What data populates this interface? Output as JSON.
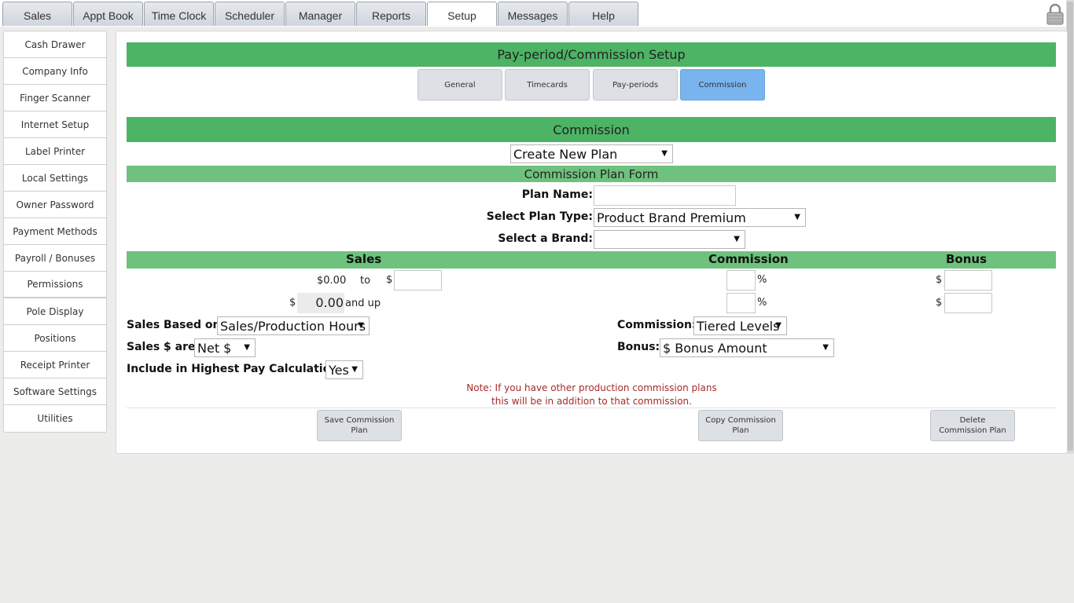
{
  "top_tabs": [
    "Sales",
    "Appt Book",
    "Time Clock",
    "Scheduler",
    "Manager",
    "Reports",
    "Setup",
    "Messages",
    "Help"
  ],
  "active_top_tab": "Setup",
  "sidebar": {
    "items": [
      "Cash Drawer",
      "Company Info",
      "Finger Scanner",
      "Internet Setup",
      "Label Printer",
      "Local Settings",
      "Owner Password",
      "Payment Methods",
      "Payroll / Bonuses",
      "Permissions",
      "Pole Display",
      "Positions",
      "Receipt Printer",
      "Software Settings",
      "Utilities"
    ]
  },
  "setup": {
    "title": "Pay-period/Commission Setup",
    "tabs": [
      "General",
      "Timecards",
      "Pay-periods",
      "Commission"
    ],
    "active_tab": "Commission"
  },
  "commission": {
    "title": "Commission",
    "plan_select": "Create New Plan",
    "form_title": "Commission Plan Form",
    "plan_name_label": "Plan Name:",
    "plan_name_value": "",
    "plan_type_label": "Select Plan Type:",
    "plan_type_value": "Product Brand Premium",
    "brand_label": "Select a Brand:",
    "brand_value": "",
    "headers": {
      "sales": "Sales",
      "commission": "Commission",
      "bonus": "Bonus"
    },
    "row1": {
      "from": "$0.00",
      "to": "to",
      "currency": "$",
      "percent": "%",
      "bonus_currency": "$"
    },
    "row2": {
      "currency": "$",
      "amount": "0.00",
      "and_up": "and up",
      "percent": "%",
      "bonus_currency": "$"
    },
    "sales_based_label": "Sales Based on:",
    "sales_based_value": "Sales/Production Hours",
    "sales_are_label": "Sales $ are:",
    "sales_are_value": "Net $",
    "highest_pay_label": "Include in Highest Pay Calculation:",
    "highest_pay_value": "Yes",
    "commission_label": "Commission:",
    "commission_value": "Tiered Levels",
    "bonus_label": "Bonus:",
    "bonus_value": "$ Bonus Amount",
    "note_line1": "Note: If you have other production commission plans",
    "note_line2": "this will be in addition to that commission.",
    "buttons": {
      "save": "Save Commission Plan",
      "copy": "Copy Commission Plan",
      "delete": "Delete Commission Plan"
    }
  }
}
